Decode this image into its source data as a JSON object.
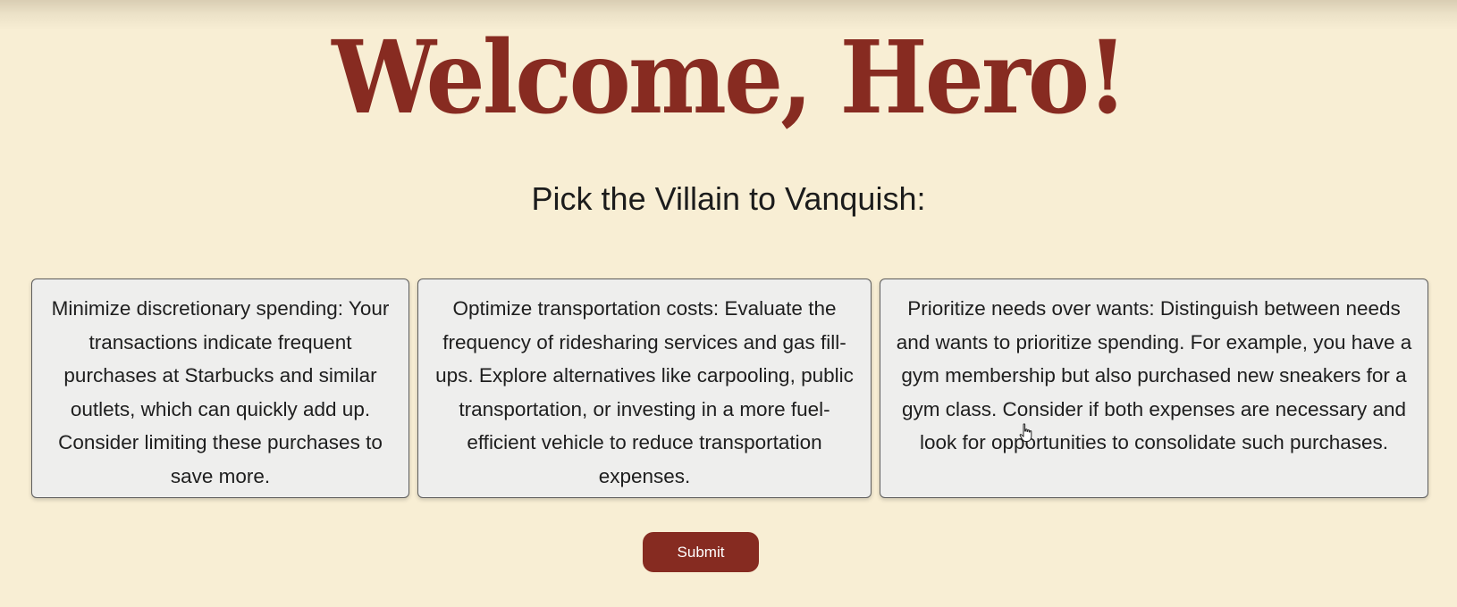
{
  "page": {
    "title": "Welcome, Hero!",
    "subtitle": "Pick the Villain to Vanquish:"
  },
  "options": [
    {
      "text": "Minimize discretionary spending: Your transactions indicate frequent purchases at Starbucks and similar outlets, which can quickly add up. Consider limiting these purchases to save more."
    },
    {
      "text": "Optimize transportation costs: Evaluate the frequency of ridesharing services and gas fill-ups. Explore alternatives like carpooling, public transportation, or investing in a more fuel-efficient vehicle to reduce transportation expenses."
    },
    {
      "text": "Prioritize needs over wants: Distinguish between needs and wants to prioritize spending. For example, you have a gym membership but also purchased new sneakers for a gym class. Consider if both expenses are necessary and look for opportunities to consolidate such purchases."
    }
  ],
  "submit_label": "Submit",
  "colors": {
    "background": "#f8eed4",
    "accent": "#872b21",
    "card_background": "#eeeeed",
    "card_border": "#5d5d5d"
  },
  "icons": {
    "cursor": "hand-pointer-icon"
  }
}
